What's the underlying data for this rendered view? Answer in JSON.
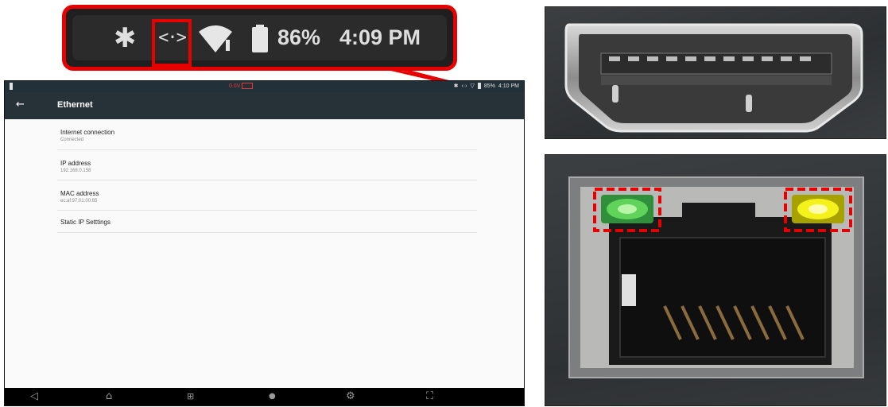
{
  "zoomed_status_bar": {
    "bluetooth_icon": "bluetooth-icon",
    "ethernet_icon": "<·>",
    "wifi_icon": "wifi-icon",
    "battery_icon": "battery-icon",
    "battery_percent": "86%",
    "time": "4:09 PM",
    "highlight_color": "#e60000"
  },
  "tablet": {
    "status_bar": {
      "center_text": "0.0V",
      "battery_percent": "85%",
      "time": "4:10 PM"
    },
    "app_bar": {
      "back_icon": "←",
      "title": "Ethernet"
    },
    "settings": [
      {
        "title": "Internet connection",
        "subtitle": "Connected"
      },
      {
        "title": "IP address",
        "subtitle": "192.168.0.158"
      },
      {
        "title": "MAC address",
        "subtitle": "ec:af:97:01:00:65"
      },
      {
        "title": "Static IP Setttings",
        "subtitle": ""
      }
    ],
    "nav_bar": {
      "back": "◁",
      "home": "⌂",
      "apps": "⊞",
      "browser": "●",
      "settings": "⚙",
      "screenshot": "⛶"
    },
    "colors": {
      "app_bar": "#263238",
      "status_bar": "#22303a",
      "nav_bar": "#000000"
    }
  },
  "photos": {
    "hdmi_port": "hdmi-port-photo",
    "ethernet_port": "ethernet-port-photo",
    "led_highlight_color": "#e60000",
    "left_led_color": "#5fd35a",
    "right_led_color": "#f4f21a"
  }
}
